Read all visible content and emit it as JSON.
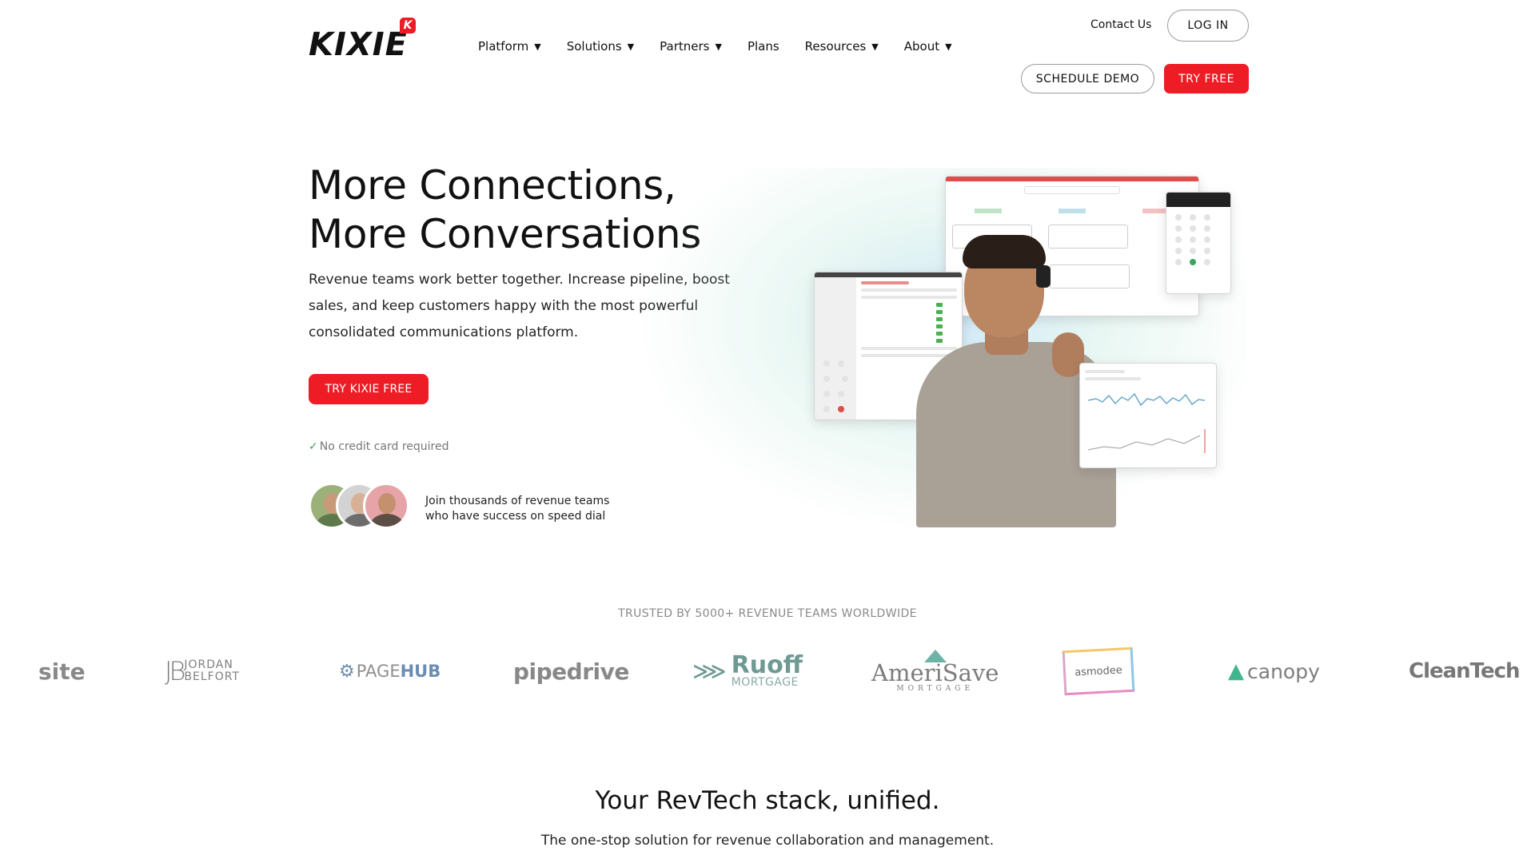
{
  "header": {
    "logo_text": "KIXIE",
    "logo_badge": "K",
    "nav": [
      {
        "label": "Platform",
        "has_menu": true
      },
      {
        "label": "Solutions",
        "has_menu": true
      },
      {
        "label": "Partners",
        "has_menu": true
      },
      {
        "label": "Plans",
        "has_menu": false
      },
      {
        "label": "Resources",
        "has_menu": true
      },
      {
        "label": "About",
        "has_menu": true
      }
    ],
    "caret": "▼",
    "contact": "Contact Us",
    "login": "LOG IN",
    "schedule_demo": "SCHEDULE DEMO",
    "try_free": "TRY FREE"
  },
  "hero": {
    "title_line1": "More Connections,",
    "title_line2": "More Conversations",
    "description": "Revenue teams work better together. Increase pipeline, boost sales, and keep customers happy with the most powerful consolidated communications platform.",
    "cta": "TRY KIXIE FREE",
    "check": "✓",
    "no_card": "No credit card required",
    "join_line1": "Join thousands of revenue teams",
    "join_line2": "who have success on speed dial"
  },
  "trusted": {
    "heading": "TRUSTED BY 5000+ REVENUE TEAMS WORLDWIDE",
    "logos": {
      "site": "site",
      "jordan_mark": "JB",
      "jordan_line1": "JORDAN",
      "jordan_line2": "BELFORT",
      "pagehub_page": "PAGE",
      "pagehub_hub": "HUB",
      "pipedrive": "pipedrive",
      "ruoff_title": "Ruoff",
      "ruoff_sub": "MORTGAGE",
      "amerisave_title": "AmeriSave",
      "amerisave_sub": "MORTGAGE",
      "asmodee": "asmodee",
      "canopy": "canopy",
      "cleantech": "CleanTech"
    }
  },
  "unified": {
    "title": "Your RevTech stack, unified.",
    "subtitle": "The one-stop solution for revenue collaboration and management."
  },
  "colors": {
    "brand_red": "#ee1c25",
    "text": "#111111",
    "muted": "#8a8a8a",
    "check_green": "#3aa55b"
  }
}
